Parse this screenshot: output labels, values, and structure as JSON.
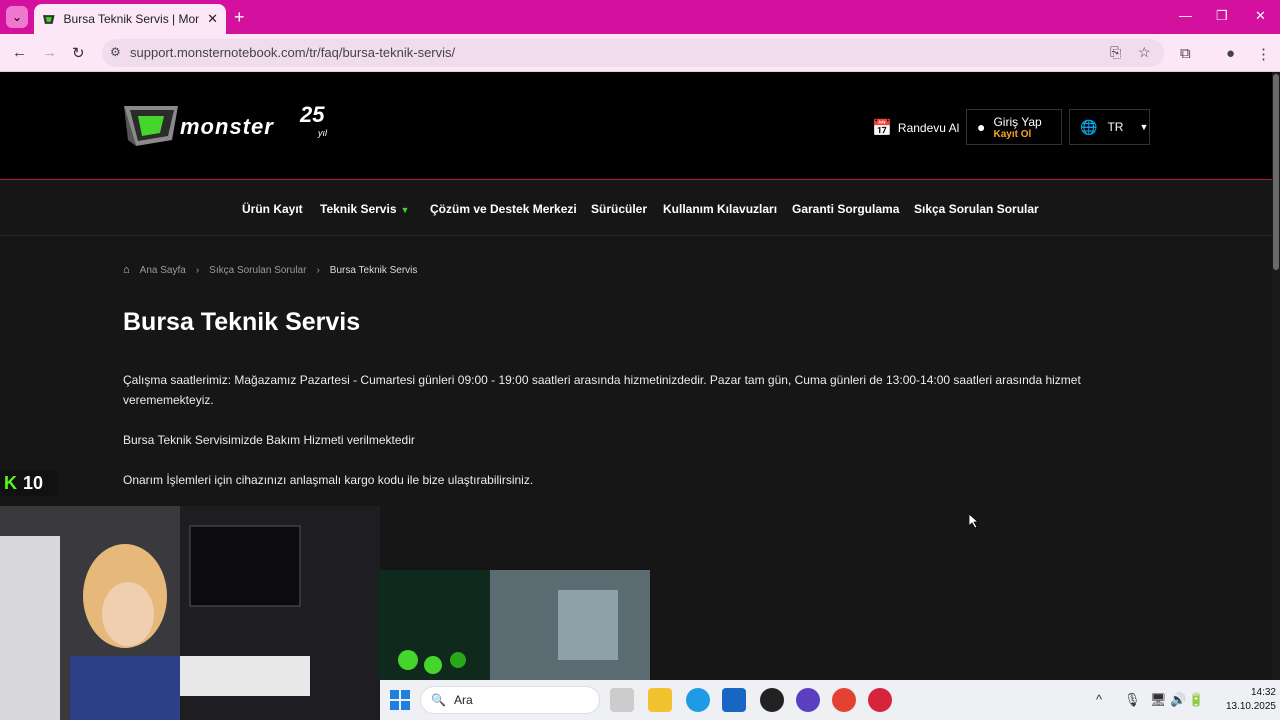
{
  "browser": {
    "tab_title": "Bursa Teknik Servis | Monster Notebook",
    "url": "support.monsternotebook.com/tr/faq/bursa-teknik-servis/",
    "new_tab": "+"
  },
  "header": {
    "logo_text": "monster",
    "logo_years": "25",
    "logo_suffix": "yıl",
    "appointment": "Randevu Al",
    "login_title": "Giriş Yap",
    "login_sub": "Kayıt Ol",
    "language": "TR"
  },
  "nav": {
    "items": [
      {
        "label": "Ürün Kayıt"
      },
      {
        "label": "Teknik Servis"
      },
      {
        "label": "Çözüm ve Destek Merkezi"
      },
      {
        "label": "Sürücüler"
      },
      {
        "label": "Kullanım Kılavuzları"
      },
      {
        "label": "Garanti Sorgulama"
      },
      {
        "label": "Sıkça Sorulan Sorular"
      }
    ]
  },
  "breadcrumb": {
    "home": "Ana Sayfa",
    "parent": "Sıkça Sorulan Sorular",
    "current": "Bursa Teknik Servis"
  },
  "content": {
    "title": "Bursa Teknik Servis",
    "p1": "Çalışma saatlerimiz: Mağazamız Pazartesi - Cumartesi günleri 09:00 - 19:00 saatleri arasında hizmetinizdedir. Pazar tam gün, Cuma günleri de 13:00-14:00 saatleri arasında hizmet verememekteyiz.",
    "p2": "Bursa Teknik Servisimizde Bakım Hizmeti verilmektedir",
    "p3": "Onarım İşlemleri için cihazınızı anlaşmalı kargo kodu ile bize ulaştırabilirsiniz."
  },
  "overlay": {
    "kick_logo": "K",
    "viewer_count": "10"
  },
  "taskbar": {
    "search_label": "Ara",
    "time": "14:32",
    "date": "13.10.2025"
  },
  "colors": {
    "tabbar": "#d4119f",
    "accent_green": "#44d62c",
    "header_border": "#b0144f",
    "login_sub": "#f5a623"
  }
}
